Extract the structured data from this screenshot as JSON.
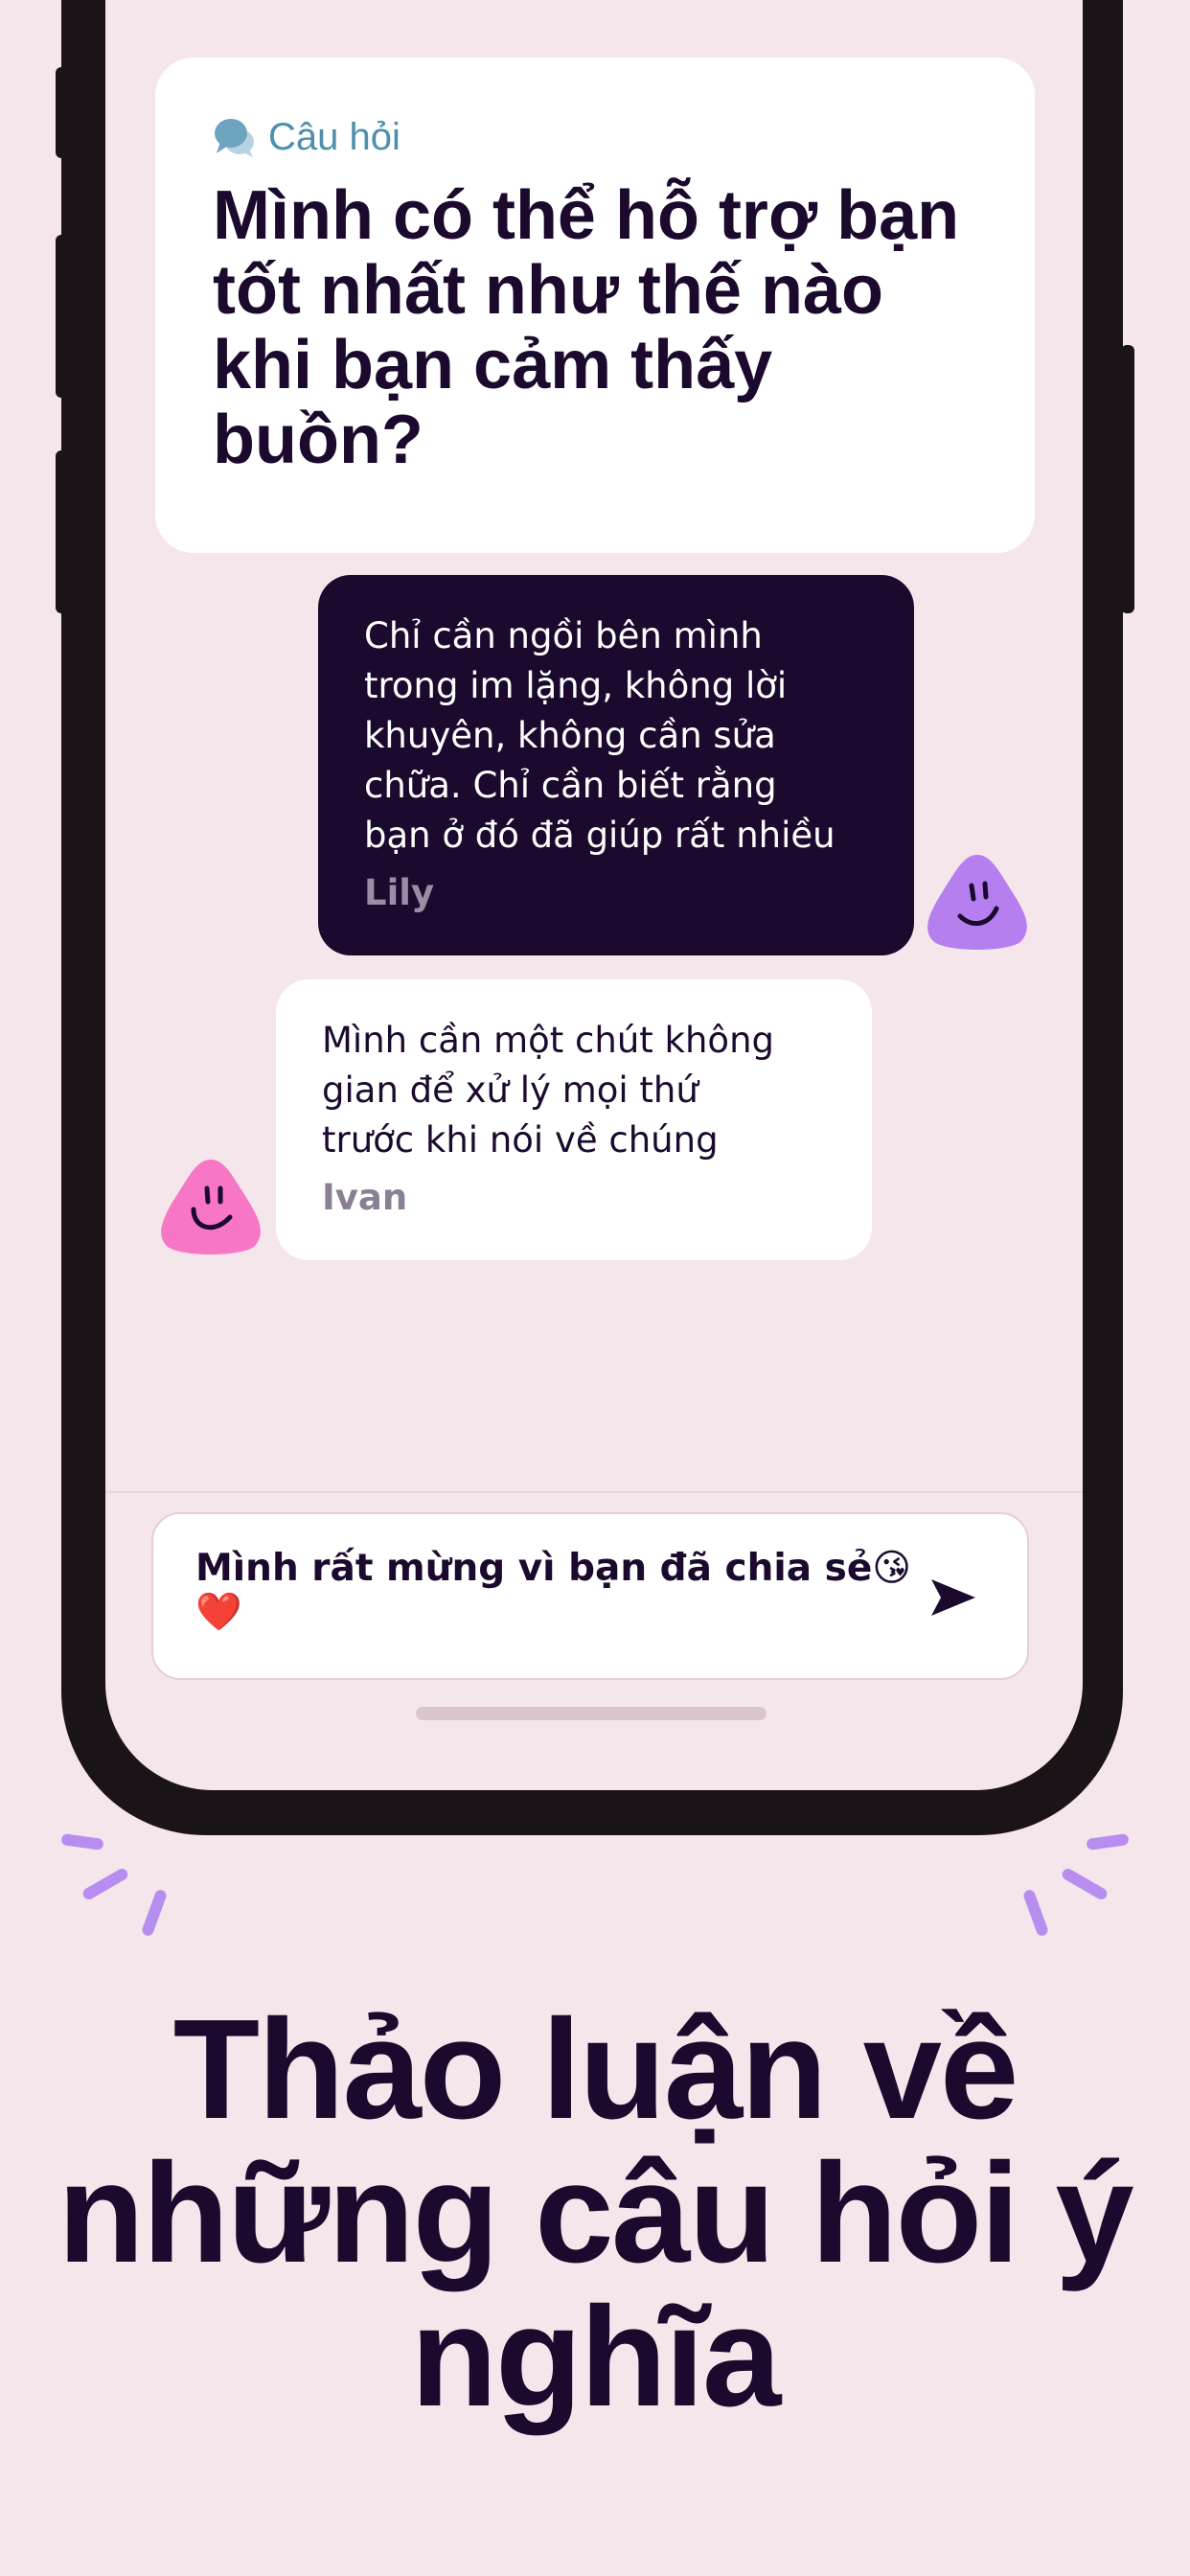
{
  "question": {
    "label": "Câu hỏi",
    "icon": "speech-bubbles-icon",
    "title": "Mình có thể hỗ trợ bạn tốt nhất như thế nào khi bạn cảm thấy buồn?"
  },
  "messages": [
    {
      "text": "Chỉ cần ngồi bên mình\ntrong im lặng, không lời\nkhuyên, không cần sửa\nchữa. Chỉ cần biết rằng\nbạn ở đó đã giúp rất nhiều",
      "author": "Lily",
      "avatar_color": "#b67ff0"
    },
    {
      "text": "Mình cần một chút không\ngian để xử lý mọi thứ\ntrước khi nói về chúng",
      "author": "Ivan",
      "avatar_color": "#f776c6"
    }
  ],
  "composer": {
    "value": "Mình rất mừng vì bạn đã chia sẻ😘❤️",
    "send_icon": "send-icon"
  },
  "headline": "Thảo luận về những câu hỏi ý nghĩa",
  "colors": {
    "background": "#f4e6ea",
    "dark": "#1c0a2e",
    "accent_blue": "#4e8fac",
    "spark": "#b78ef0"
  }
}
